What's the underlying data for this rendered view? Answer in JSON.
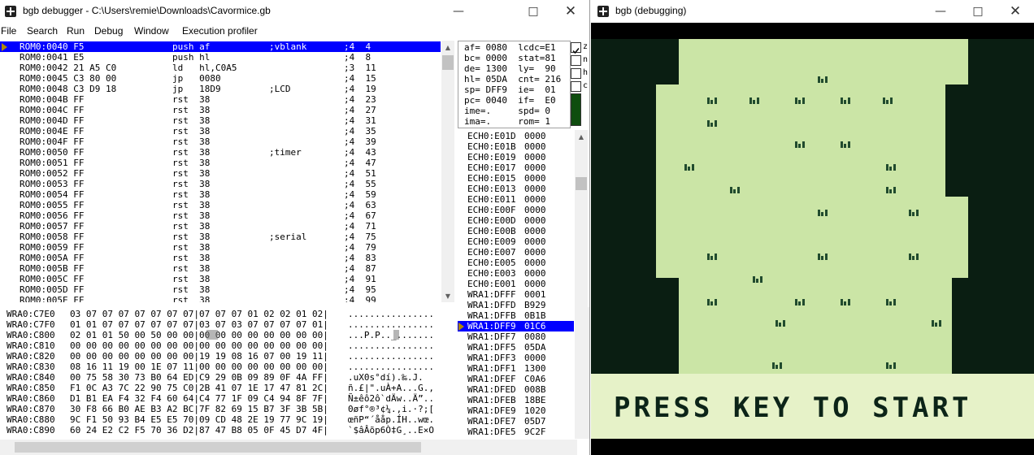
{
  "debugger": {
    "title": "bgb debugger - C:\\Users\\remie\\Downloads\\Cavormice.gb",
    "menu": [
      "File",
      "Search",
      "Run",
      "Debug",
      "Window",
      "Execution profiler"
    ],
    "disasm": [
      {
        "addr": "ROM0:0040 F5",
        "op": "push af",
        "comment": ";vblank",
        "cyc": ";4  4",
        "sel": true
      },
      {
        "addr": "ROM0:0041 E5",
        "op": "push hl",
        "comment": "",
        "cyc": ";4  8"
      },
      {
        "addr": "ROM0:0042 21 A5 C0",
        "op": "ld   hl,C0A5",
        "comment": "",
        "cyc": ";3  11"
      },
      {
        "addr": "ROM0:0045 C3 80 00",
        "op": "jp   0080",
        "comment": "",
        "cyc": ";4  15"
      },
      {
        "addr": "ROM0:0048 C3 D9 18",
        "op": "jp   18D9",
        "comment": ";LCD",
        "cyc": ";4  19"
      },
      {
        "addr": "ROM0:004B FF",
        "op": "rst  38",
        "comment": "",
        "cyc": ";4  23"
      },
      {
        "addr": "ROM0:004C FF",
        "op": "rst  38",
        "comment": "",
        "cyc": ";4  27"
      },
      {
        "addr": "ROM0:004D FF",
        "op": "rst  38",
        "comment": "",
        "cyc": ";4  31"
      },
      {
        "addr": "ROM0:004E FF",
        "op": "rst  38",
        "comment": "",
        "cyc": ";4  35"
      },
      {
        "addr": "ROM0:004F FF",
        "op": "rst  38",
        "comment": "",
        "cyc": ";4  39"
      },
      {
        "addr": "ROM0:0050 FF",
        "op": "rst  38",
        "comment": ";timer",
        "cyc": ";4  43"
      },
      {
        "addr": "ROM0:0051 FF",
        "op": "rst  38",
        "comment": "",
        "cyc": ";4  47"
      },
      {
        "addr": "ROM0:0052 FF",
        "op": "rst  38",
        "comment": "",
        "cyc": ";4  51"
      },
      {
        "addr": "ROM0:0053 FF",
        "op": "rst  38",
        "comment": "",
        "cyc": ";4  55"
      },
      {
        "addr": "ROM0:0054 FF",
        "op": "rst  38",
        "comment": "",
        "cyc": ";4  59"
      },
      {
        "addr": "ROM0:0055 FF",
        "op": "rst  38",
        "comment": "",
        "cyc": ";4  63"
      },
      {
        "addr": "ROM0:0056 FF",
        "op": "rst  38",
        "comment": "",
        "cyc": ";4  67"
      },
      {
        "addr": "ROM0:0057 FF",
        "op": "rst  38",
        "comment": "",
        "cyc": ";4  71"
      },
      {
        "addr": "ROM0:0058 FF",
        "op": "rst  38",
        "comment": ";serial",
        "cyc": ";4  75"
      },
      {
        "addr": "ROM0:0059 FF",
        "op": "rst  38",
        "comment": "",
        "cyc": ";4  79"
      },
      {
        "addr": "ROM0:005A FF",
        "op": "rst  38",
        "comment": "",
        "cyc": ";4  83"
      },
      {
        "addr": "ROM0:005B FF",
        "op": "rst  38",
        "comment": "",
        "cyc": ";4  87"
      },
      {
        "addr": "ROM0:005C FF",
        "op": "rst  38",
        "comment": "",
        "cyc": ";4  91"
      },
      {
        "addr": "ROM0:005D FF",
        "op": "rst  38",
        "comment": "",
        "cyc": ";4  95"
      },
      {
        "addr": "ROM0:005E FF",
        "op": "rst  38",
        "comment": "",
        "cyc": ";4  99"
      }
    ],
    "registers": [
      "af= 0080  lcdc=E1",
      "bc= 0000  stat=81",
      "de= 1300  ly=  90",
      "hl= 05DA  cnt= 216",
      "sp= DFF9  ie=  01",
      "pc= 0040  if=  E0",
      "ime=.     spd= 0",
      "ima=.     rom= 1"
    ],
    "flags": [
      {
        "label": "z",
        "checked": true
      },
      {
        "label": "n",
        "checked": false
      },
      {
        "label": "h",
        "checked": false
      },
      {
        "label": "c",
        "checked": false
      }
    ],
    "stack": [
      {
        "addr": "ECH0:E01D",
        "val": "0000"
      },
      {
        "addr": "ECH0:E01B",
        "val": "0000"
      },
      {
        "addr": "ECH0:E019",
        "val": "0000"
      },
      {
        "addr": "ECH0:E017",
        "val": "0000"
      },
      {
        "addr": "ECH0:E015",
        "val": "0000"
      },
      {
        "addr": "ECH0:E013",
        "val": "0000"
      },
      {
        "addr": "ECH0:E011",
        "val": "0000"
      },
      {
        "addr": "ECH0:E00F",
        "val": "0000"
      },
      {
        "addr": "ECH0:E00D",
        "val": "0000"
      },
      {
        "addr": "ECH0:E00B",
        "val": "0000"
      },
      {
        "addr": "ECH0:E009",
        "val": "0000"
      },
      {
        "addr": "ECH0:E007",
        "val": "0000"
      },
      {
        "addr": "ECH0:E005",
        "val": "0000"
      },
      {
        "addr": "ECH0:E003",
        "val": "0000"
      },
      {
        "addr": "ECH0:E001",
        "val": "0000"
      },
      {
        "addr": "WRA1:DFFF",
        "val": "0001"
      },
      {
        "addr": "WRA1:DFFD",
        "val": "B929"
      },
      {
        "addr": "WRA1:DFFB",
        "val": "0B1B"
      },
      {
        "addr": "WRA1:DFF9",
        "val": "01C6",
        "sel": true
      },
      {
        "addr": "WRA1:DFF7",
        "val": "0080"
      },
      {
        "addr": "WRA1:DFF5",
        "val": "05DA"
      },
      {
        "addr": "WRA1:DFF3",
        "val": "0000"
      },
      {
        "addr": "WRA1:DFF1",
        "val": "1300"
      },
      {
        "addr": "WRA1:DFEF",
        "val": "C0A6"
      },
      {
        "addr": "WRA1:DFED",
        "val": "008B"
      },
      {
        "addr": "WRA1:DFEB",
        "val": "18BE"
      },
      {
        "addr": "WRA1:DFE9",
        "val": "1020"
      },
      {
        "addr": "WRA1:DFE7",
        "val": "05D7"
      },
      {
        "addr": "WRA1:DFE5",
        "val": "9C2F"
      }
    ],
    "memory": [
      {
        "addr": "WRA0:C7E0",
        "hex": "03 07 07 07 07 07 07 07|07 07 07 01 02 02 01 02|",
        "ascii": "................"
      },
      {
        "addr": "WRA0:C7F0",
        "hex": "01 01 07 07 07 07 07 07|03 07 03 07 07 07 07 01|",
        "ascii": "................"
      },
      {
        "addr": "WRA0:C800",
        "hex": "02 01 01 50 00 50 00 00|00 00 00 00 00 00 00 00|",
        "ascii": "...P.P.._......."
      },
      {
        "addr": "WRA0:C810",
        "hex": "00 00 00 00 00 00 00 00|00 00 00 00 00 00 00 00|",
        "ascii": "................"
      },
      {
        "addr": "WRA0:C820",
        "hex": "00 00 00 00 00 00 00 00|19 19 08 16 07 00 19 11|",
        "ascii": "................"
      },
      {
        "addr": "WRA0:C830",
        "hex": "08 16 11 19 00 1E 07 11|00 00 00 00 00 00 00 00|",
        "ascii": "................"
      },
      {
        "addr": "WRA0:C840",
        "hex": "00 75 58 30 73 B0 64 ED|C9 29 0B 09 89 0F 4A FF|",
        "ascii": ".uX0s°dí).‰.J."
      },
      {
        "addr": "WRA0:C850",
        "hex": "F1 0C A3 7C 22 90 75 C0|2B 41 07 1E 17 47 81 2C|",
        "ascii": "ñ.£|\".uÀ+A...G.,"
      },
      {
        "addr": "WRA0:C860",
        "hex": "D1 B1 EA F4 32 F4 60 64|C4 77 1F 09 C4 94 8F 7F|",
        "ascii": "Ñ±êô2ô`dÄw..Ä”.."
      },
      {
        "addr": "WRA0:C870",
        "hex": "30 F8 66 B0 AE B3 A2 BC|7F 82 69 15 B7 3F 3B 5B|",
        "ascii": "0øf°®³¢¼.‚i.·?;["
      },
      {
        "addr": "WRA0:C880",
        "hex": "9C F1 50 93 B4 E5 E5 70|09 CD 48 2E 19 77 9C 19|",
        "ascii": "œñP“´ååp.ÍH..wœ."
      },
      {
        "addr": "WRA0:C890",
        "hex": "60 24 E2 C2 F5 70 36 D2|87 47 B8 05 0F 45 D7 4F|",
        "ascii": "`$âÂõp6Ò‡G¸..E×O"
      }
    ]
  },
  "game": {
    "title": "bgb (debugging)",
    "prompt": "PRESS KEY TO START"
  }
}
